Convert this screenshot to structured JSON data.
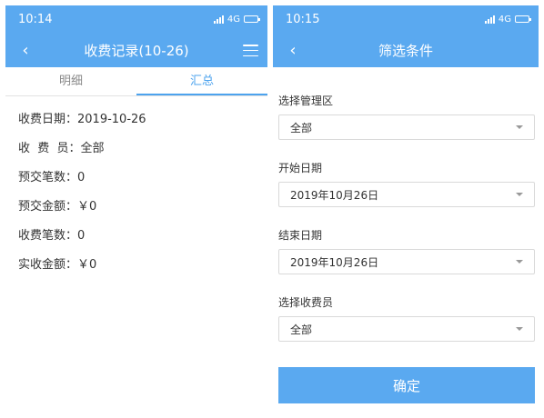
{
  "left": {
    "status": {
      "time": "10:14",
      "network": "4G"
    },
    "nav": {
      "title": "收费记录(10-26)",
      "back_glyph": "‹"
    },
    "tabs": [
      {
        "label": "明细",
        "active": false
      },
      {
        "label": "汇总",
        "active": true
      }
    ],
    "summary": [
      {
        "text": "收费日期：2019-10-26"
      },
      {
        "text": "收  费  员：全部"
      },
      {
        "text": "预交笔数：0"
      },
      {
        "text": "预交金额：￥0"
      },
      {
        "text": "收费笔数：0"
      },
      {
        "text": "实收金额：￥0"
      }
    ]
  },
  "right": {
    "status": {
      "time": "10:15",
      "network": "4G"
    },
    "nav": {
      "title": "筛选条件",
      "back_glyph": "‹"
    },
    "fields": [
      {
        "label": "选择管理区",
        "value": "全部"
      },
      {
        "label": "开始日期",
        "value": "2019年10月26日"
      },
      {
        "label": "结束日期",
        "value": "2019年10月26日"
      },
      {
        "label": "选择收费员",
        "value": "全部"
      }
    ],
    "confirm_label": "确定"
  },
  "colors": {
    "brand": "#5aa9f0",
    "tab_active": "#4da3ee"
  },
  "icons": [
    "back-icon",
    "menu-icon",
    "signal-icon",
    "battery-icon",
    "dropdown-caret-icon"
  ]
}
